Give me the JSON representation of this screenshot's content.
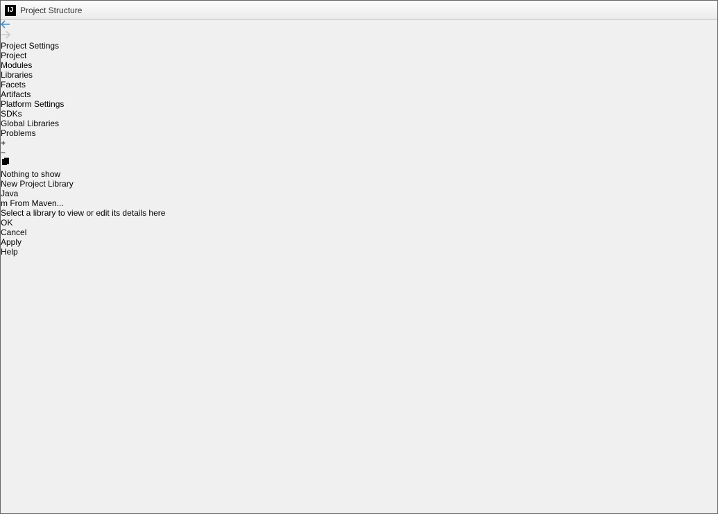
{
  "window": {
    "title": "Project Structure"
  },
  "sidebar": {
    "section1_header": "Project Settings",
    "section1_items": [
      "Project",
      "Modules",
      "Libraries",
      "Facets",
      "Artifacts"
    ],
    "section1_selected": 2,
    "section2_header": "Platform Settings",
    "section2_items": [
      "SDKs",
      "Global Libraries"
    ],
    "section3_items": [
      "Problems"
    ]
  },
  "middle": {
    "empty_text": "Nothing to show"
  },
  "popup": {
    "title": "New Project Library",
    "items": [
      {
        "icon": "java",
        "label": "Java",
        "selected": true
      },
      {
        "icon": "maven",
        "label": "From Maven...",
        "selected": false
      }
    ]
  },
  "detail": {
    "message": "Select a library to view or edit its details here"
  },
  "buttons": {
    "ok": "OK",
    "cancel": "Cancel",
    "apply": "Apply",
    "help": "Help"
  }
}
